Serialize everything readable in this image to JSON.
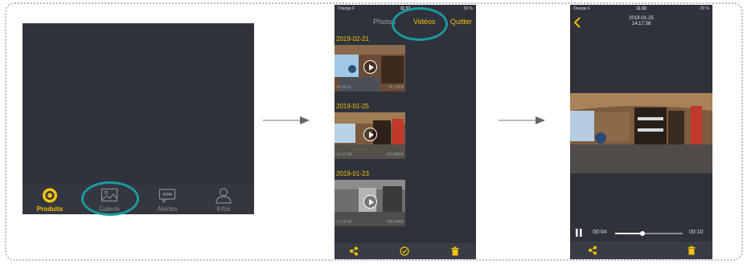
{
  "screen1": {
    "tabs": [
      {
        "label": "Produits",
        "icon": "products-icon",
        "active": true
      },
      {
        "label": "Galerie",
        "icon": "gallery-icon",
        "active": false
      },
      {
        "label": "Alertes",
        "icon": "alerts-icon",
        "active": false
      },
      {
        "label": "Infos",
        "icon": "infos-icon",
        "active": false
      }
    ]
  },
  "screen2": {
    "status": {
      "carrier": "Orange F",
      "time": "11:32",
      "battery": "29 %"
    },
    "nav": {
      "photos": "Photos",
      "videos": "Vidéos",
      "quit": "Quitter"
    },
    "groups": [
      {
        "date": "2019-02-21",
        "time": "14:44:11",
        "size": "76.19KB"
      },
      {
        "date": "2019-01-25",
        "time": "14:17:38",
        "size": "153.80KB"
      },
      {
        "date": "2019-01-23",
        "time": "21:00:38",
        "size": "780.44KB"
      }
    ]
  },
  "screen3": {
    "status": {
      "carrier": "Orange F",
      "time": "11:32",
      "battery": "29 %"
    },
    "title_date": "2019-01-25",
    "title_time": "14:17:38",
    "elapsed": "00:04",
    "duration": "00:10",
    "progress": 0.4
  },
  "colors": {
    "accent": "#f4c20d",
    "highlight": "#1a9aa0",
    "background": "#2f323b"
  }
}
